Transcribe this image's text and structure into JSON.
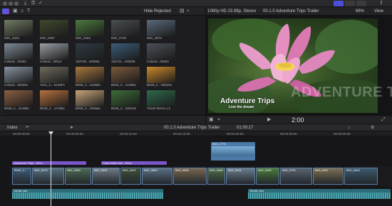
{
  "toolbar": {
    "library_icons": [
      "import-icon",
      "keyword-icon",
      "check-icon"
    ],
    "right_icons": [
      "layout-icon",
      "export-icon"
    ]
  },
  "browser": {
    "filter_label": "Hide Rejected",
    "clips": [
      {
        "name": "IMG_0322",
        "color": "#6f7c63"
      },
      {
        "name": "IMG_0367",
        "color": "#3f4a2d"
      },
      {
        "name": "IMG_0453",
        "color": "#4c7a3c"
      },
      {
        "name": "IMG_0730",
        "color": "#4a4e52"
      },
      {
        "name": "IMG_0873",
        "color": "#5a6a7c"
      },
      {
        "name": "Iceland...00494",
        "color": "#7d8a96"
      },
      {
        "name": "Iceland...00514",
        "color": "#9aa0a6"
      },
      {
        "name": "153730...v00083",
        "color": "#2f3a44"
      },
      {
        "name": "152731...v00035",
        "color": "#3b5c7a"
      },
      {
        "name": "Iceland...00820",
        "color": "#4b5057"
      },
      {
        "name": "Iceland...00026s",
        "color": "#8793a0"
      },
      {
        "name": "A011_C...5148Fs",
        "color": "#6e6a5c"
      },
      {
        "name": "B009_C...2105bs",
        "color": "#a8773f"
      },
      {
        "name": "B025_C...2105bs",
        "color": "#7a5a3b"
      },
      {
        "name": "B029_C...0533Xs",
        "color": "#c98a2a"
      },
      {
        "name": "B028_C...2146bs",
        "color": "#8c5f43"
      },
      {
        "name": "B028_C...1476bs",
        "color": "#b5713c"
      },
      {
        "name": "B009_C...0036as",
        "color": "#c7a47a"
      },
      {
        "name": "B025_C...0252Xs",
        "color": "#3d6d3a"
      },
      {
        "name": "Travel theme v.2",
        "color": "#2e6a4b"
      }
    ]
  },
  "viewer": {
    "format": "1080p HD 23.98p, Stereo",
    "project": "00.1.0 Adventure Trips Trailer",
    "zoom": "66%",
    "view_label": "View",
    "overlay_title": "Adventure Trips",
    "overlay_subtitle": "Live the dream",
    "overlay_ghost": "ADVENTURE TRIPS",
    "timecode": "2:00"
  },
  "timeline": {
    "index_label": "Index",
    "project_label": "00.1.0 Adventure Trips Trailer",
    "duration": "01:00:17",
    "ruler_ticks": [
      "00:00:00:00",
      "00:00:05:00",
      "00:00:10:00",
      "00:00:15:00",
      "00:00:20:00",
      "00:00:25:00",
      "00:00:30:00"
    ],
    "connected_clip": "IMG_1776",
    "titles": [
      "Adventure Trips - Echo",
      "China Mobi-Inst - Echo"
    ],
    "primary_clips": [
      "B025_C...",
      "IMG_0373",
      "IMG_0360",
      "IMG_0391",
      "IMG_0322",
      "IMG_0853",
      "IMG_0395",
      "IMG_0460",
      "IMG_0431",
      "IMG_0453",
      "IMG_0720",
      "IMG_0437",
      "IMG_0443"
    ],
    "audio_clips": [
      "Gentle rain",
      "Gentle river"
    ]
  }
}
